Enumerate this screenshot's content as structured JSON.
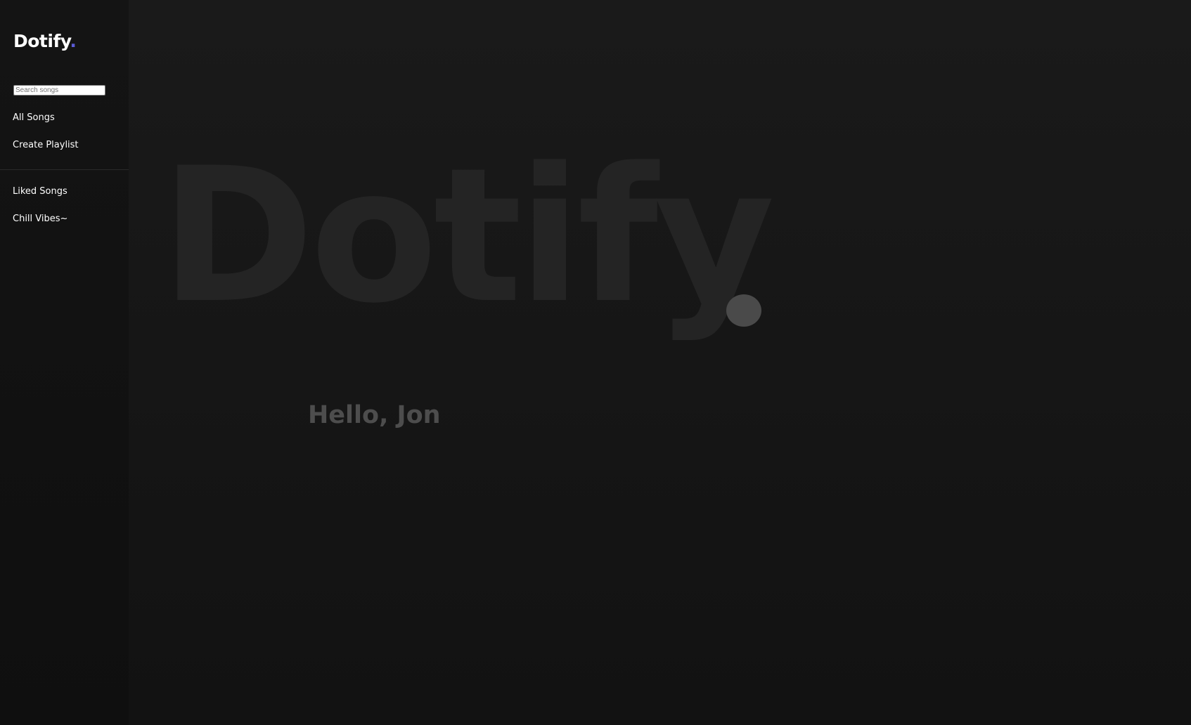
{
  "app": {
    "logo_text": "Dotify",
    "logo_dot": ".",
    "accent_color": "#5b5bd6"
  },
  "sidebar": {
    "search": {
      "placeholder": "Search songs",
      "value": ""
    },
    "primary_items": [
      {
        "label": "All Songs"
      },
      {
        "label": "Create Playlist"
      }
    ],
    "playlists": [
      {
        "label": "Liked Songs"
      },
      {
        "label": "Chill Vibes~"
      }
    ]
  },
  "main": {
    "hero_text": "Dotify",
    "greeting": "Hello, Jon"
  }
}
